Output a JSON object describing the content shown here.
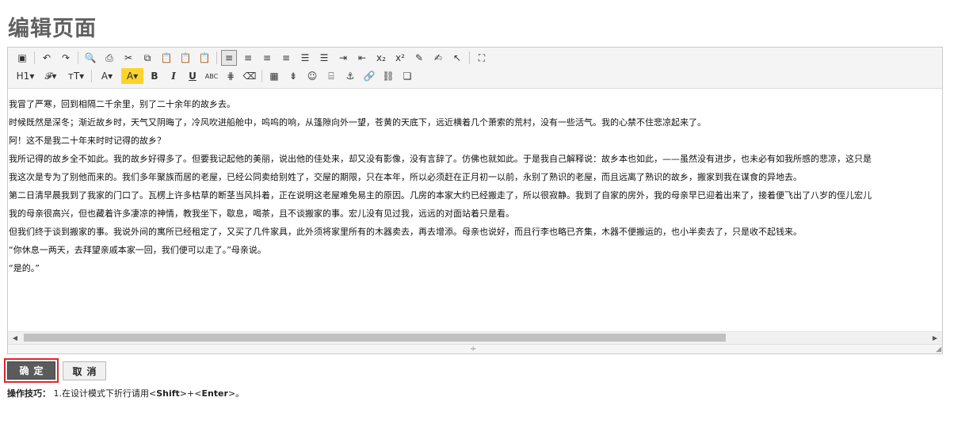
{
  "page": {
    "title": "编辑页面"
  },
  "toolbar": {
    "row1": [
      {
        "name": "insert-image-icon",
        "glyph": "▣",
        "active": false
      },
      {
        "sep": true
      },
      {
        "name": "undo-icon",
        "glyph": "↶",
        "active": false
      },
      {
        "name": "redo-icon",
        "glyph": "↷",
        "active": false
      },
      {
        "sep": true
      },
      {
        "name": "preview-icon",
        "glyph": "🔍",
        "active": false
      },
      {
        "name": "print-icon",
        "glyph": "⎙",
        "active": false
      },
      {
        "name": "cut-icon",
        "glyph": "✂",
        "active": false
      },
      {
        "name": "copy-icon",
        "glyph": "⧉",
        "active": false
      },
      {
        "name": "paste-icon",
        "glyph": "📋",
        "active": false
      },
      {
        "name": "paste-text-icon",
        "glyph": "📋",
        "active": false
      },
      {
        "name": "paste-word-icon",
        "glyph": "📋",
        "active": false
      },
      {
        "sep": true
      },
      {
        "name": "align-left-icon",
        "glyph": "≡",
        "active": true
      },
      {
        "name": "align-center-icon",
        "glyph": "≡",
        "active": false
      },
      {
        "name": "align-right-icon",
        "glyph": "≡",
        "active": false
      },
      {
        "name": "align-justify-icon",
        "glyph": "≡",
        "active": false
      },
      {
        "name": "ordered-list-icon",
        "glyph": "☰",
        "active": false
      },
      {
        "name": "unordered-list-icon",
        "glyph": "☰",
        "active": false
      },
      {
        "name": "indent-icon",
        "glyph": "⇥",
        "active": false
      },
      {
        "name": "outdent-icon",
        "glyph": "⇤",
        "active": false
      },
      {
        "name": "subscript-icon",
        "glyph": "x₂",
        "active": false
      },
      {
        "name": "superscript-icon",
        "glyph": "x²",
        "active": false
      },
      {
        "name": "clear-format-icon",
        "glyph": "✎",
        "active": false
      },
      {
        "name": "format-painter-icon",
        "glyph": "✍",
        "active": false
      },
      {
        "name": "select-all-icon",
        "glyph": "↖",
        "active": false
      },
      {
        "sep": true
      },
      {
        "name": "fullscreen-icon",
        "glyph": "⛶",
        "active": false
      }
    ],
    "row2": [
      {
        "name": "heading-dropdown",
        "glyph": "H1▾",
        "wide": true
      },
      {
        "name": "font-family-dropdown",
        "glyph": "𝓕▾",
        "wide": true
      },
      {
        "name": "font-size-dropdown",
        "glyph": "тT▾",
        "wide": true
      },
      {
        "sep": true
      },
      {
        "name": "font-color-dropdown",
        "glyph": "A▾",
        "wide": true
      },
      {
        "name": "highlight-color-dropdown",
        "glyph": "A▾",
        "wide": true,
        "highlight": true
      },
      {
        "name": "bold-icon",
        "glyph": "B",
        "bold": true
      },
      {
        "name": "italic-icon",
        "glyph": "I",
        "italic": true
      },
      {
        "name": "underline-icon",
        "glyph": "U",
        "underline": true
      },
      {
        "name": "strikethrough-icon",
        "glyph": "ABC",
        "small": true
      },
      {
        "name": "horizontal-rule-icon",
        "glyph": "⋕"
      },
      {
        "name": "eraser-icon",
        "glyph": "⌫"
      },
      {
        "sep": true
      },
      {
        "name": "table-icon",
        "glyph": "▦"
      },
      {
        "name": "insert-row-icon",
        "glyph": "⇟"
      },
      {
        "name": "emoticon-icon",
        "glyph": "☺"
      },
      {
        "name": "page-break-icon",
        "glyph": "⌸"
      },
      {
        "name": "anchor-icon",
        "glyph": "⚓"
      },
      {
        "name": "link-icon",
        "glyph": "🔗"
      },
      {
        "name": "unlink-icon",
        "glyph": "⛓"
      },
      {
        "name": "source-code-icon",
        "glyph": "❏"
      }
    ]
  },
  "editor": {
    "paragraphs": [
      "我冒了严寒，回到相隔二千余里，别了二十余年的故乡去。",
      "时候既然是深冬；渐近故乡时，天气又阴晦了，冷风吹进船舱中，呜呜的响，从篷隙向外一望，苍黄的天底下，远近横着几个萧索的荒村，没有一些活气。我的心禁不住悲凉起来了。",
      "阿！这不是我二十年来时时记得的故乡？",
      "我所记得的故乡全不如此。我的故乡好得多了。但要我记起他的美丽，说出他的佳处来，却又没有影像，没有言辞了。仿佛也就如此。于是我自己解释说：故乡本也如此，——虽然没有进步，也未必有如我所感的悲凉，这只是",
      "我这次是专为了别他而来的。我们多年聚族而居的老屋，已经公同卖给别姓了，交屋的期限，只在本年，所以必须赶在正月初一以前，永别了熟识的老屋，而且远离了熟识的故乡，搬家到我在谋食的异地去。",
      "第二日清早晨我到了我家的门口了。瓦楞上许多枯草的断茎当风抖着，正在说明这老屋难免易主的原因。几房的本家大约已经搬走了，所以很寂静。我到了自家的房外，我的母亲早已迎着出来了，接着便飞出了八岁的侄儿宏儿",
      "我的母亲很高兴，但也藏着许多凄凉的神情，教我坐下，歇息，喝茶，且不谈搬家的事。宏儿没有见过我，远远的对面站着只是看。",
      "但我们终于谈到搬家的事。我说外间的寓所已经租定了，又买了几件家具，此外须将家里所有的木器卖去，再去增添。母亲也说好，而且行李也略已齐集，木器不便搬运的，也小半卖去了，只是收不起钱来。",
      "“你休息一两天，去拜望亲戚本家一回，我们便可以走了。”母亲说。",
      "“是的。”"
    ]
  },
  "buttons": {
    "ok_label": "确定",
    "cancel_label": "取消"
  },
  "tip": {
    "label": "操作技巧：",
    "text_before": "1.在设计模式下折行请用<",
    "shift": "Shift",
    "mid": ">+<",
    "enter": "Enter",
    "text_after": ">。"
  }
}
